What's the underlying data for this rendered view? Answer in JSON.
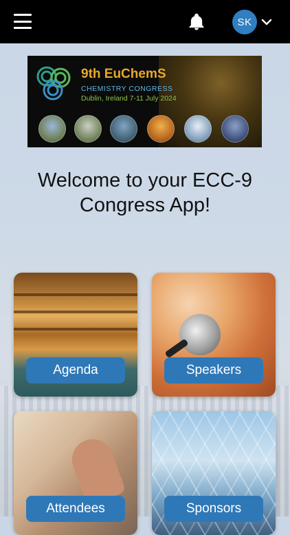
{
  "header": {
    "menu_icon": "hamburger-menu-icon",
    "notification_icon": "bell-icon",
    "user_initials": "SK",
    "dropdown_icon": "chevron-down-icon",
    "background": "#000000",
    "avatar_color": "#2f7fc1"
  },
  "banner": {
    "title": "9th EuChemS",
    "subtitle": "CHEMISTRY CONGRESS",
    "location_dates": "Dublin, Ireland 7-11 July 2024"
  },
  "welcome": {
    "line1": "Welcome to your ECC-9",
    "line2": "Congress App!"
  },
  "tiles": [
    {
      "label": "Agenda"
    },
    {
      "label": "Speakers"
    },
    {
      "label": "Attendees"
    },
    {
      "label": "Sponsors"
    }
  ],
  "colors": {
    "tile_button": "#2f78b8"
  }
}
